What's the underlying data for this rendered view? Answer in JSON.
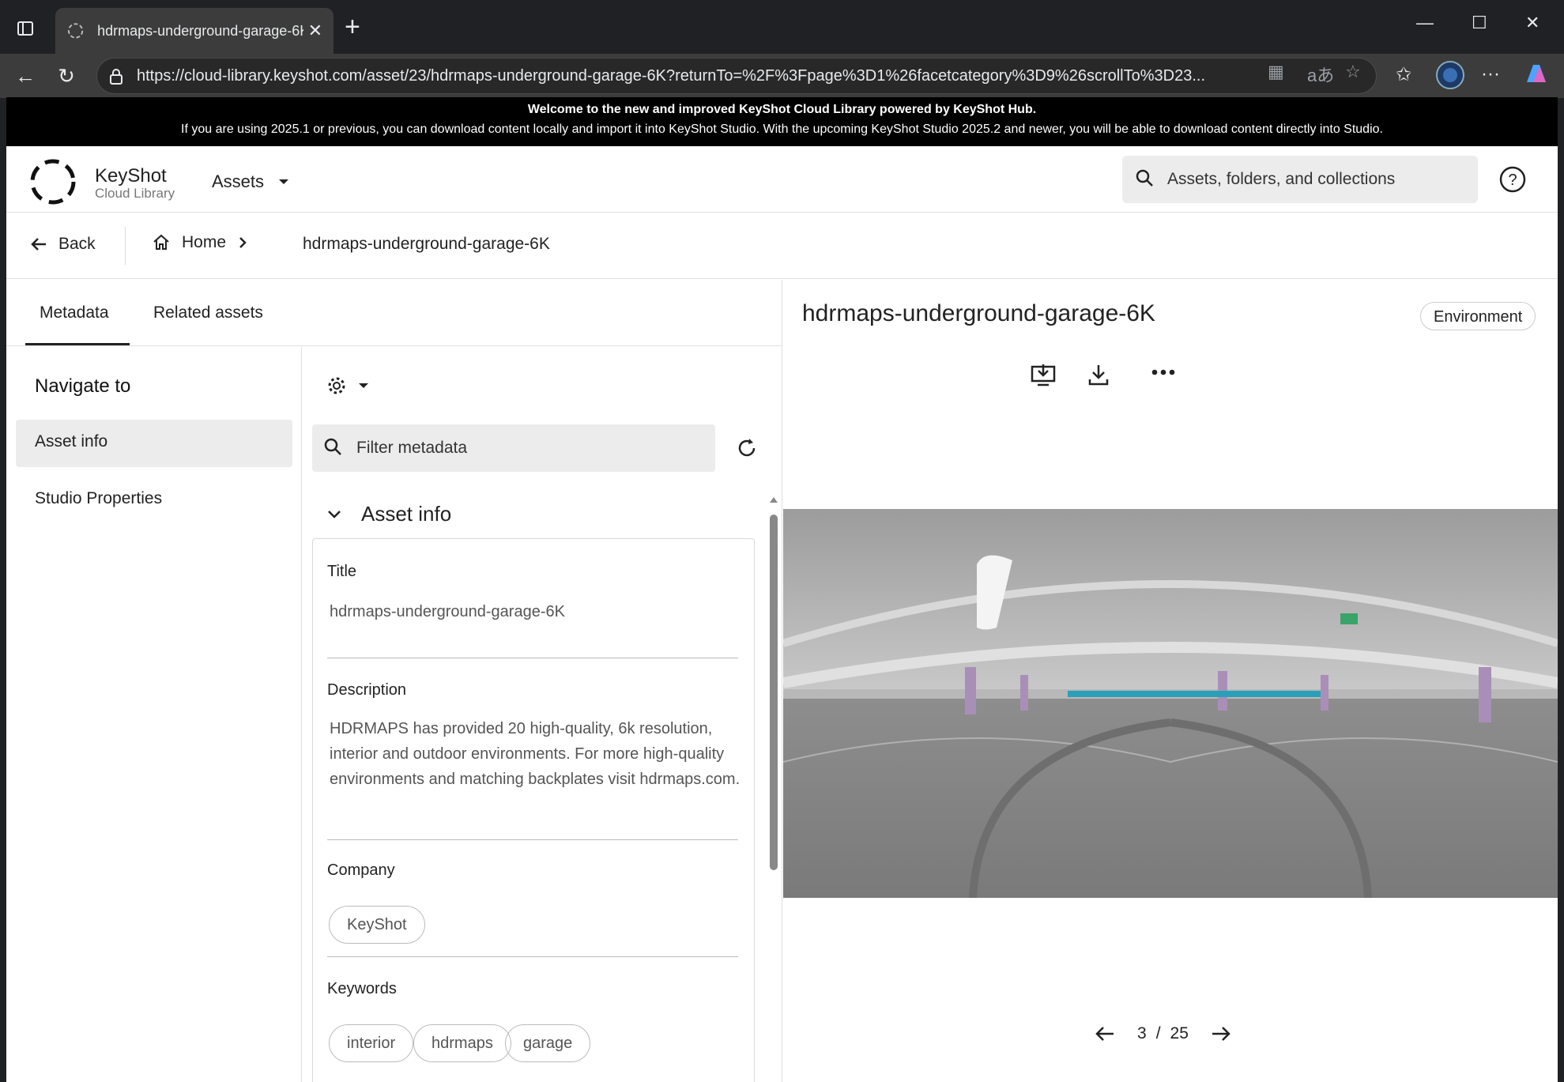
{
  "browser": {
    "tab_title": "hdrmaps-underground-garage-6K",
    "url": "https://cloud-library.keyshot.com/asset/23/hdrmaps-underground-garage-6K?returnTo=%2F%3Fpage%3D1%26facetcategory%3D9%26scrollTo%3D23..."
  },
  "banner": {
    "line1": "Welcome to the new and improved KeyShot Cloud Library powered by KeyShot Hub.",
    "line2": "If you are using 2025.1 or previous, you can download content locally and import it into KeyShot Studio. With the upcoming KeyShot Studio 2025.2 and newer, you will be able to download content directly into Studio."
  },
  "header": {
    "brand_name": "KeyShot",
    "brand_sub": "Cloud Library",
    "assets_menu": "Assets",
    "search_placeholder": "Assets, folders, and collections"
  },
  "breadcrumb": {
    "back": "Back",
    "home": "Home",
    "current": "hdrmaps-underground-garage-6K"
  },
  "tabs": [
    {
      "label": "Metadata",
      "active": true
    },
    {
      "label": "Related assets",
      "active": false
    }
  ],
  "navigate": {
    "heading": "Navigate to",
    "items": [
      {
        "label": "Asset info",
        "active": true
      },
      {
        "label": "Studio Properties",
        "active": false
      }
    ]
  },
  "metadata": {
    "filter_placeholder": "Filter metadata",
    "section_title": "Asset info",
    "title_label": "Title",
    "title_value": "hdrmaps-underground-garage-6K",
    "description_label": "Description",
    "description_value": "HDRMAPS has provided 20 high-quality, 6k resolution, interior and outdoor environments. For more high-quality environments and matching backplates visit hdrmaps.com.",
    "company_label": "Company",
    "company_chip": "KeyShot",
    "keywords_label": "Keywords",
    "keywords": [
      "interior",
      "hdrmaps",
      "garage"
    ]
  },
  "asset": {
    "title": "hdrmaps-underground-garage-6K",
    "type_chip": "Environment",
    "pager_current": "3",
    "pager_sep": "/",
    "pager_total": "25"
  },
  "colors": {
    "banner_bg": "#000000",
    "chrome_bg": "#202124",
    "active_nav_bg": "#ececec"
  }
}
